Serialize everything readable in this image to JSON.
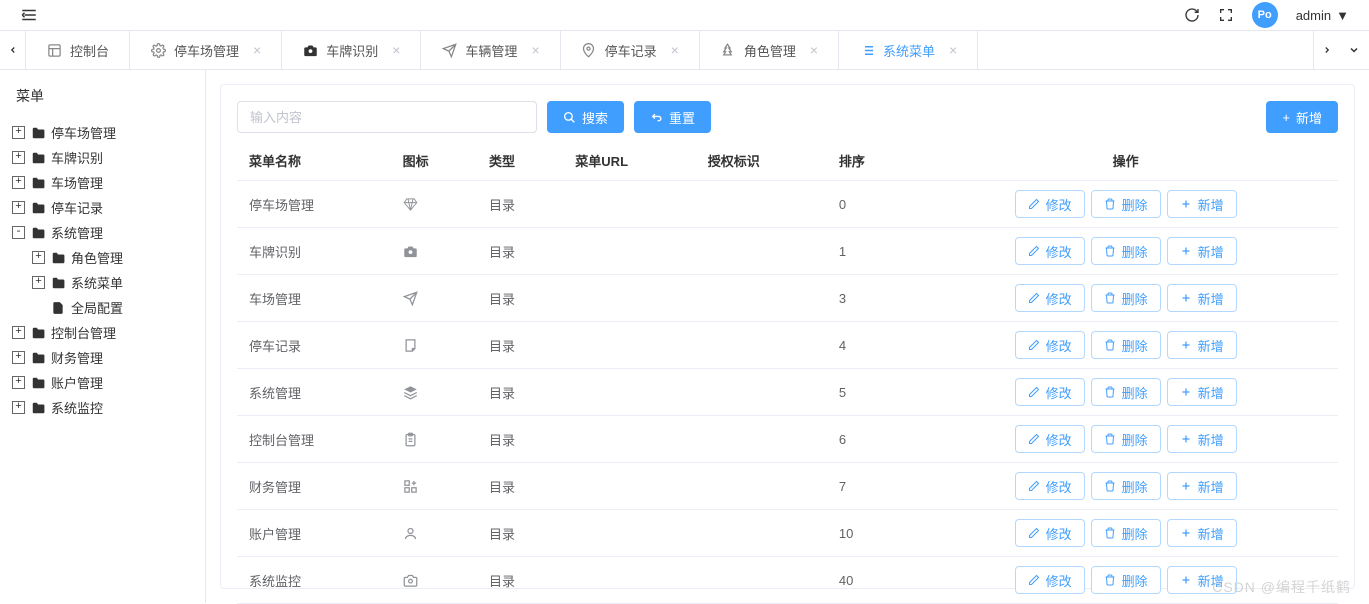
{
  "topbar": {
    "user_name": "admin"
  },
  "tabs": [
    {
      "label": "控制台",
      "icon": "dashboard",
      "closable": false,
      "active": false
    },
    {
      "label": "停车场管理",
      "icon": "gear",
      "closable": true,
      "active": false
    },
    {
      "label": "车牌识别",
      "icon": "camera-solid",
      "closable": true,
      "active": false
    },
    {
      "label": "车辆管理",
      "icon": "send",
      "closable": true,
      "active": false
    },
    {
      "label": "停车记录",
      "icon": "pin",
      "closable": true,
      "active": false
    },
    {
      "label": "角色管理",
      "icon": "tree",
      "closable": true,
      "active": false
    },
    {
      "label": "系统菜单",
      "icon": "list",
      "closable": true,
      "active": true
    }
  ],
  "sidebar": {
    "title": "菜单",
    "nodes": [
      {
        "label": "停车场管理",
        "state": "plus",
        "icon": "folder"
      },
      {
        "label": "车牌识别",
        "state": "plus",
        "icon": "folder"
      },
      {
        "label": "车场管理",
        "state": "plus",
        "icon": "folder"
      },
      {
        "label": "停车记录",
        "state": "plus",
        "icon": "folder"
      },
      {
        "label": "系统管理",
        "state": "minus",
        "icon": "folder",
        "children": [
          {
            "label": "角色管理",
            "state": "plus",
            "icon": "folder"
          },
          {
            "label": "系统菜单",
            "state": "plus",
            "icon": "folder"
          },
          {
            "label": "全局配置",
            "state": "leaf",
            "icon": "file"
          }
        ]
      },
      {
        "label": "控制台管理",
        "state": "plus",
        "icon": "folder"
      },
      {
        "label": "财务管理",
        "state": "plus",
        "icon": "folder"
      },
      {
        "label": "账户管理",
        "state": "plus",
        "icon": "folder"
      },
      {
        "label": "系统监控",
        "state": "plus",
        "icon": "folder"
      }
    ]
  },
  "toolbar": {
    "search_placeholder": "输入内容",
    "search_label": "搜索",
    "reset_label": "重置",
    "add_label": "新增"
  },
  "table": {
    "columns": [
      "菜单名称",
      "图标",
      "类型",
      "菜单URL",
      "授权标识",
      "排序",
      "操作"
    ],
    "type_label": "目录",
    "edit_label": "修改",
    "delete_label": "删除",
    "add_label": "新增",
    "rows": [
      {
        "name": "停车场管理",
        "icon": "diamond",
        "sort": "0"
      },
      {
        "name": "车牌识别",
        "icon": "camera-solid",
        "sort": "1"
      },
      {
        "name": "车场管理",
        "icon": "send",
        "sort": "3"
      },
      {
        "name": "停车记录",
        "icon": "note",
        "sort": "4"
      },
      {
        "name": "系统管理",
        "icon": "stack",
        "sort": "5"
      },
      {
        "name": "控制台管理",
        "icon": "clipboard",
        "sort": "6"
      },
      {
        "name": "财务管理",
        "icon": "apps",
        "sort": "7"
      },
      {
        "name": "账户管理",
        "icon": "user",
        "sort": "10"
      },
      {
        "name": "系统监控",
        "icon": "camera",
        "sort": "40"
      }
    ]
  },
  "watermark": "CSDN @编程千纸鹤"
}
